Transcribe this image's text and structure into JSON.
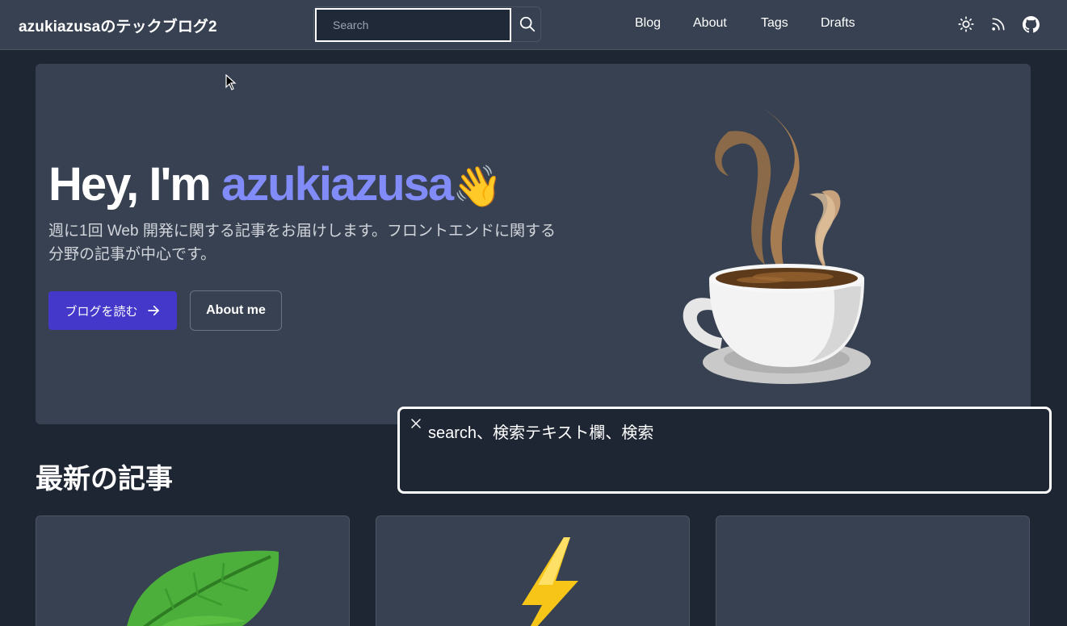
{
  "header": {
    "site_title": "azukiazusaのテックブログ2",
    "search": {
      "placeholder": "Search",
      "value": ""
    },
    "nav": [
      {
        "label": "Blog"
      },
      {
        "label": "About"
      },
      {
        "label": "Tags"
      },
      {
        "label": "Drafts"
      }
    ],
    "icons": [
      "sun-icon",
      "rss-icon",
      "github-icon"
    ]
  },
  "hero": {
    "greeting": "Hey, I'm ",
    "name": "azukiazusa",
    "wave_emoji": "👋",
    "description_line1": "週に1回 Web 開発に関する記事をお届けします。フロントエンドに関する",
    "description_line2": "分野の記事が中心です。",
    "primary_button": "ブログを読む",
    "secondary_button": "About me"
  },
  "latest": {
    "title": "最新の記事",
    "cards": [
      {
        "image": "leaf"
      },
      {
        "image": "lightning"
      },
      {
        "image": ""
      }
    ]
  },
  "tooltip": {
    "text": "search、検索テキスト欄、検索"
  },
  "colors": {
    "background": "#1f2633",
    "surface": "#374151",
    "accent": "#818cf8",
    "primary_button": "#4338ca"
  }
}
